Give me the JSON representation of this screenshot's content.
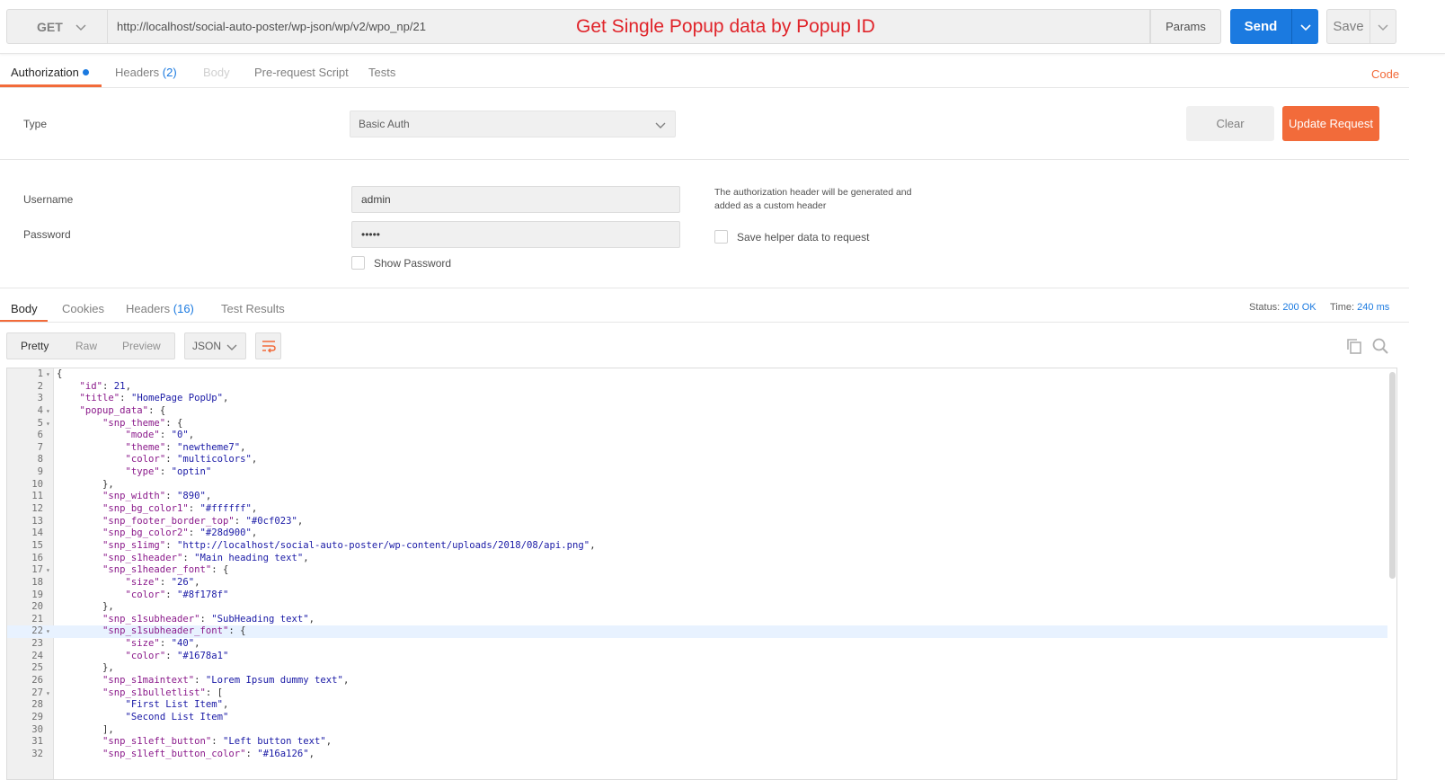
{
  "request": {
    "method": "GET",
    "url": "http://localhost/social-auto-poster/wp-json/wp/v2/wpo_np/21",
    "annotation": "Get Single Popup data by Popup ID",
    "params_label": "Params",
    "send_label": "Send",
    "save_label": "Save"
  },
  "request_tabs": {
    "authorization": "Authorization",
    "headers": "Headers",
    "headers_count": "(2)",
    "body": "Body",
    "prerequest": "Pre-request Script",
    "tests": "Tests",
    "code": "Code"
  },
  "auth": {
    "type_label": "Type",
    "type_value": "Basic Auth",
    "clear_label": "Clear",
    "update_label": "Update Request",
    "username_label": "Username",
    "username_value": "admin",
    "password_label": "Password",
    "password_value": "•••••",
    "show_password_label": "Show Password",
    "hint_line1": "The authorization header will be generated and",
    "hint_line2": "added as a custom header",
    "save_helper_label": "Save helper data to request"
  },
  "response_tabs": {
    "body": "Body",
    "cookies": "Cookies",
    "headers": "Headers",
    "headers_count": "(16)",
    "test_results": "Test Results",
    "status_label": "Status:",
    "status_value": "200 OK",
    "time_label": "Time:",
    "time_value": "240 ms"
  },
  "body_toolbar": {
    "pretty": "Pretty",
    "raw": "Raw",
    "preview": "Preview",
    "format": "JSON"
  },
  "colors": {
    "accent_orange": "#f26b3a",
    "send_blue": "#1b7ae0",
    "annotation_red": "#e0242a"
  },
  "code_lines": [
    {
      "n": "1",
      "fold": true,
      "t": "{"
    },
    {
      "n": "2",
      "t": "    \"id\": 21,"
    },
    {
      "n": "3",
      "t": "    \"title\": \"HomePage PopUp\","
    },
    {
      "n": "4",
      "fold": true,
      "t": "    \"popup_data\": {"
    },
    {
      "n": "5",
      "fold": true,
      "t": "        \"snp_theme\": {"
    },
    {
      "n": "6",
      "t": "            \"mode\": \"0\","
    },
    {
      "n": "7",
      "t": "            \"theme\": \"newtheme7\","
    },
    {
      "n": "8",
      "t": "            \"color\": \"multicolors\","
    },
    {
      "n": "9",
      "t": "            \"type\": \"optin\""
    },
    {
      "n": "10",
      "t": "        },"
    },
    {
      "n": "11",
      "t": "        \"snp_width\": \"890\","
    },
    {
      "n": "12",
      "t": "        \"snp_bg_color1\": \"#ffffff\","
    },
    {
      "n": "13",
      "t": "        \"snp_footer_border_top\": \"#0cf023\","
    },
    {
      "n": "14",
      "t": "        \"snp_bg_color2\": \"#28d900\","
    },
    {
      "n": "15",
      "t": "        \"snp_s1img\": \"http://localhost/social-auto-poster/wp-content/uploads/2018/08/api.png\","
    },
    {
      "n": "16",
      "t": "        \"snp_s1header\": \"Main heading text\","
    },
    {
      "n": "17",
      "fold": true,
      "t": "        \"snp_s1header_font\": {"
    },
    {
      "n": "18",
      "t": "            \"size\": \"26\","
    },
    {
      "n": "19",
      "t": "            \"color\": \"#8f178f\""
    },
    {
      "n": "20",
      "t": "        },"
    },
    {
      "n": "21",
      "t": "        \"snp_s1subheader\": \"SubHeading text\","
    },
    {
      "n": "22",
      "fold": true,
      "hl": true,
      "t": "        \"snp_s1subheader_font\": {"
    },
    {
      "n": "23",
      "t": "            \"size\": \"40\","
    },
    {
      "n": "24",
      "t": "            \"color\": \"#1678a1\""
    },
    {
      "n": "25",
      "t": "        },"
    },
    {
      "n": "26",
      "t": "        \"snp_s1maintext\": \"Lorem Ipsum dummy text\","
    },
    {
      "n": "27",
      "fold": true,
      "t": "        \"snp_s1bulletlist\": ["
    },
    {
      "n": "28",
      "t": "            \"First List Item\","
    },
    {
      "n": "29",
      "t": "            \"Second List Item\""
    },
    {
      "n": "30",
      "t": "        ],"
    },
    {
      "n": "31",
      "t": "        \"snp_s1left_button\": \"Left button text\","
    },
    {
      "n": "32",
      "t": "        \"snp_s1left_button_color\": \"#16a126\","
    }
  ]
}
